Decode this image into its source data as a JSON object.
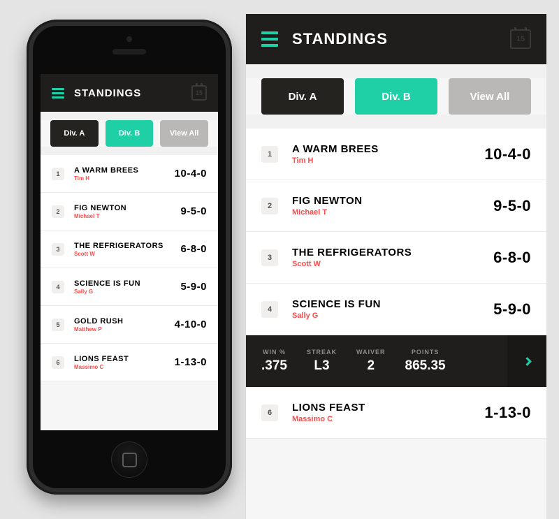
{
  "header": {
    "title": "STANDINGS",
    "calendar_day": "15"
  },
  "tabs": {
    "a": "Div. A",
    "b": "Div. B",
    "all": "View All"
  },
  "teams": [
    {
      "rank": "1",
      "name": "A WARM BREES",
      "owner": "Tim H",
      "record": "10-4-0"
    },
    {
      "rank": "2",
      "name": "FIG NEWTON",
      "owner": "Michael T",
      "record": "9-5-0"
    },
    {
      "rank": "3",
      "name": "THE REFRIGERATORS",
      "owner": "Scott W",
      "record": "6-8-0"
    },
    {
      "rank": "4",
      "name": "SCIENCE IS FUN",
      "owner": "Sally G",
      "record": "5-9-0"
    },
    {
      "rank": "5",
      "name": "GOLD RUSH",
      "owner": "Matthew P",
      "record": "4-10-0"
    },
    {
      "rank": "6",
      "name": "LIONS FEAST",
      "owner": "Massimo C",
      "record": "1-13-0"
    }
  ],
  "detail": {
    "winpct_label": "WIN %",
    "winpct": ".375",
    "streak_label": "STREAK",
    "streak": "L3",
    "waiver_label": "WAIVER",
    "waiver": "2",
    "points_label": "POINTS",
    "points": "865.35"
  }
}
